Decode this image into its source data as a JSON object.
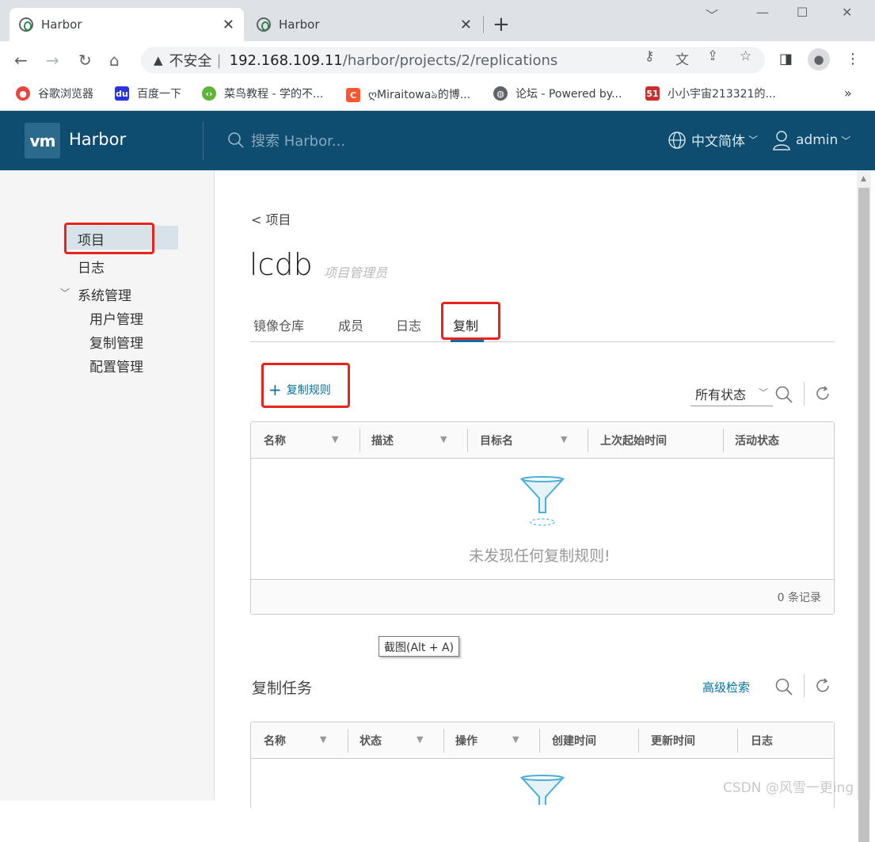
{
  "browser": {
    "tabs": [
      {
        "title": "Harbor",
        "active": true
      },
      {
        "title": "Harbor",
        "active": false
      }
    ],
    "address": {
      "security_label": "不安全",
      "host": "192.168.109.11",
      "path": "/harbor/projects/2/replications"
    },
    "bookmarks": [
      {
        "label": "谷歌浏览器",
        "icon": "chrome-icon",
        "color": "#e8453c"
      },
      {
        "label": "百度一下",
        "icon": "baidu-paw-icon",
        "color": "#2932e1"
      },
      {
        "label": "菜鸟教程 - 学的不...",
        "icon": "runoob-icon",
        "color": "#5fb336"
      },
      {
        "label": "ღMiraitowaঌ的博...",
        "icon": "csdn-c-icon",
        "color": "#fc5531"
      },
      {
        "label": "论坛 - Powered by...",
        "icon": "globe-icon",
        "color": "#5f6368"
      },
      {
        "label": "小小宇宙213321的...",
        "icon": "51cto-icon",
        "color": "#c9302c"
      }
    ]
  },
  "harbor": {
    "brand": "Harbor",
    "logo_text": "vm",
    "search_placeholder": "搜索 Harbor...",
    "language": "中文简体",
    "user": "admin",
    "header_color": "#0e4d70"
  },
  "sidebar": {
    "items": [
      {
        "label": "项目",
        "active": true
      },
      {
        "label": "日志"
      },
      {
        "label": "系统管理",
        "expanded": true
      },
      {
        "label": "用户管理"
      },
      {
        "label": "复制管理"
      },
      {
        "label": "配置管理"
      }
    ]
  },
  "project": {
    "back_label": "< 项目",
    "name": "lcdb",
    "role": "项目管理员",
    "tabs": [
      "镜像仓库",
      "成员",
      "日志",
      "复制"
    ],
    "active_tab": "复制"
  },
  "rules": {
    "add_label": "复制规则",
    "status_filter": "所有状态",
    "columns": [
      "名称",
      "描述",
      "目标名",
      "上次起始时间",
      "活动状态"
    ],
    "empty_text": "未发现任何复制规则!",
    "footer": "0 条记录"
  },
  "tooltip": "截图(Alt + A)",
  "jobs": {
    "title": "复制任务",
    "advanced_search": "高级检索",
    "columns": [
      "名称",
      "状态",
      "操作",
      "创建时间",
      "更新时间",
      "日志"
    ]
  },
  "watermark": "CSDN @风雪一更ing",
  "accent_color": "#0072a3",
  "highlight_color": "#e8231d"
}
